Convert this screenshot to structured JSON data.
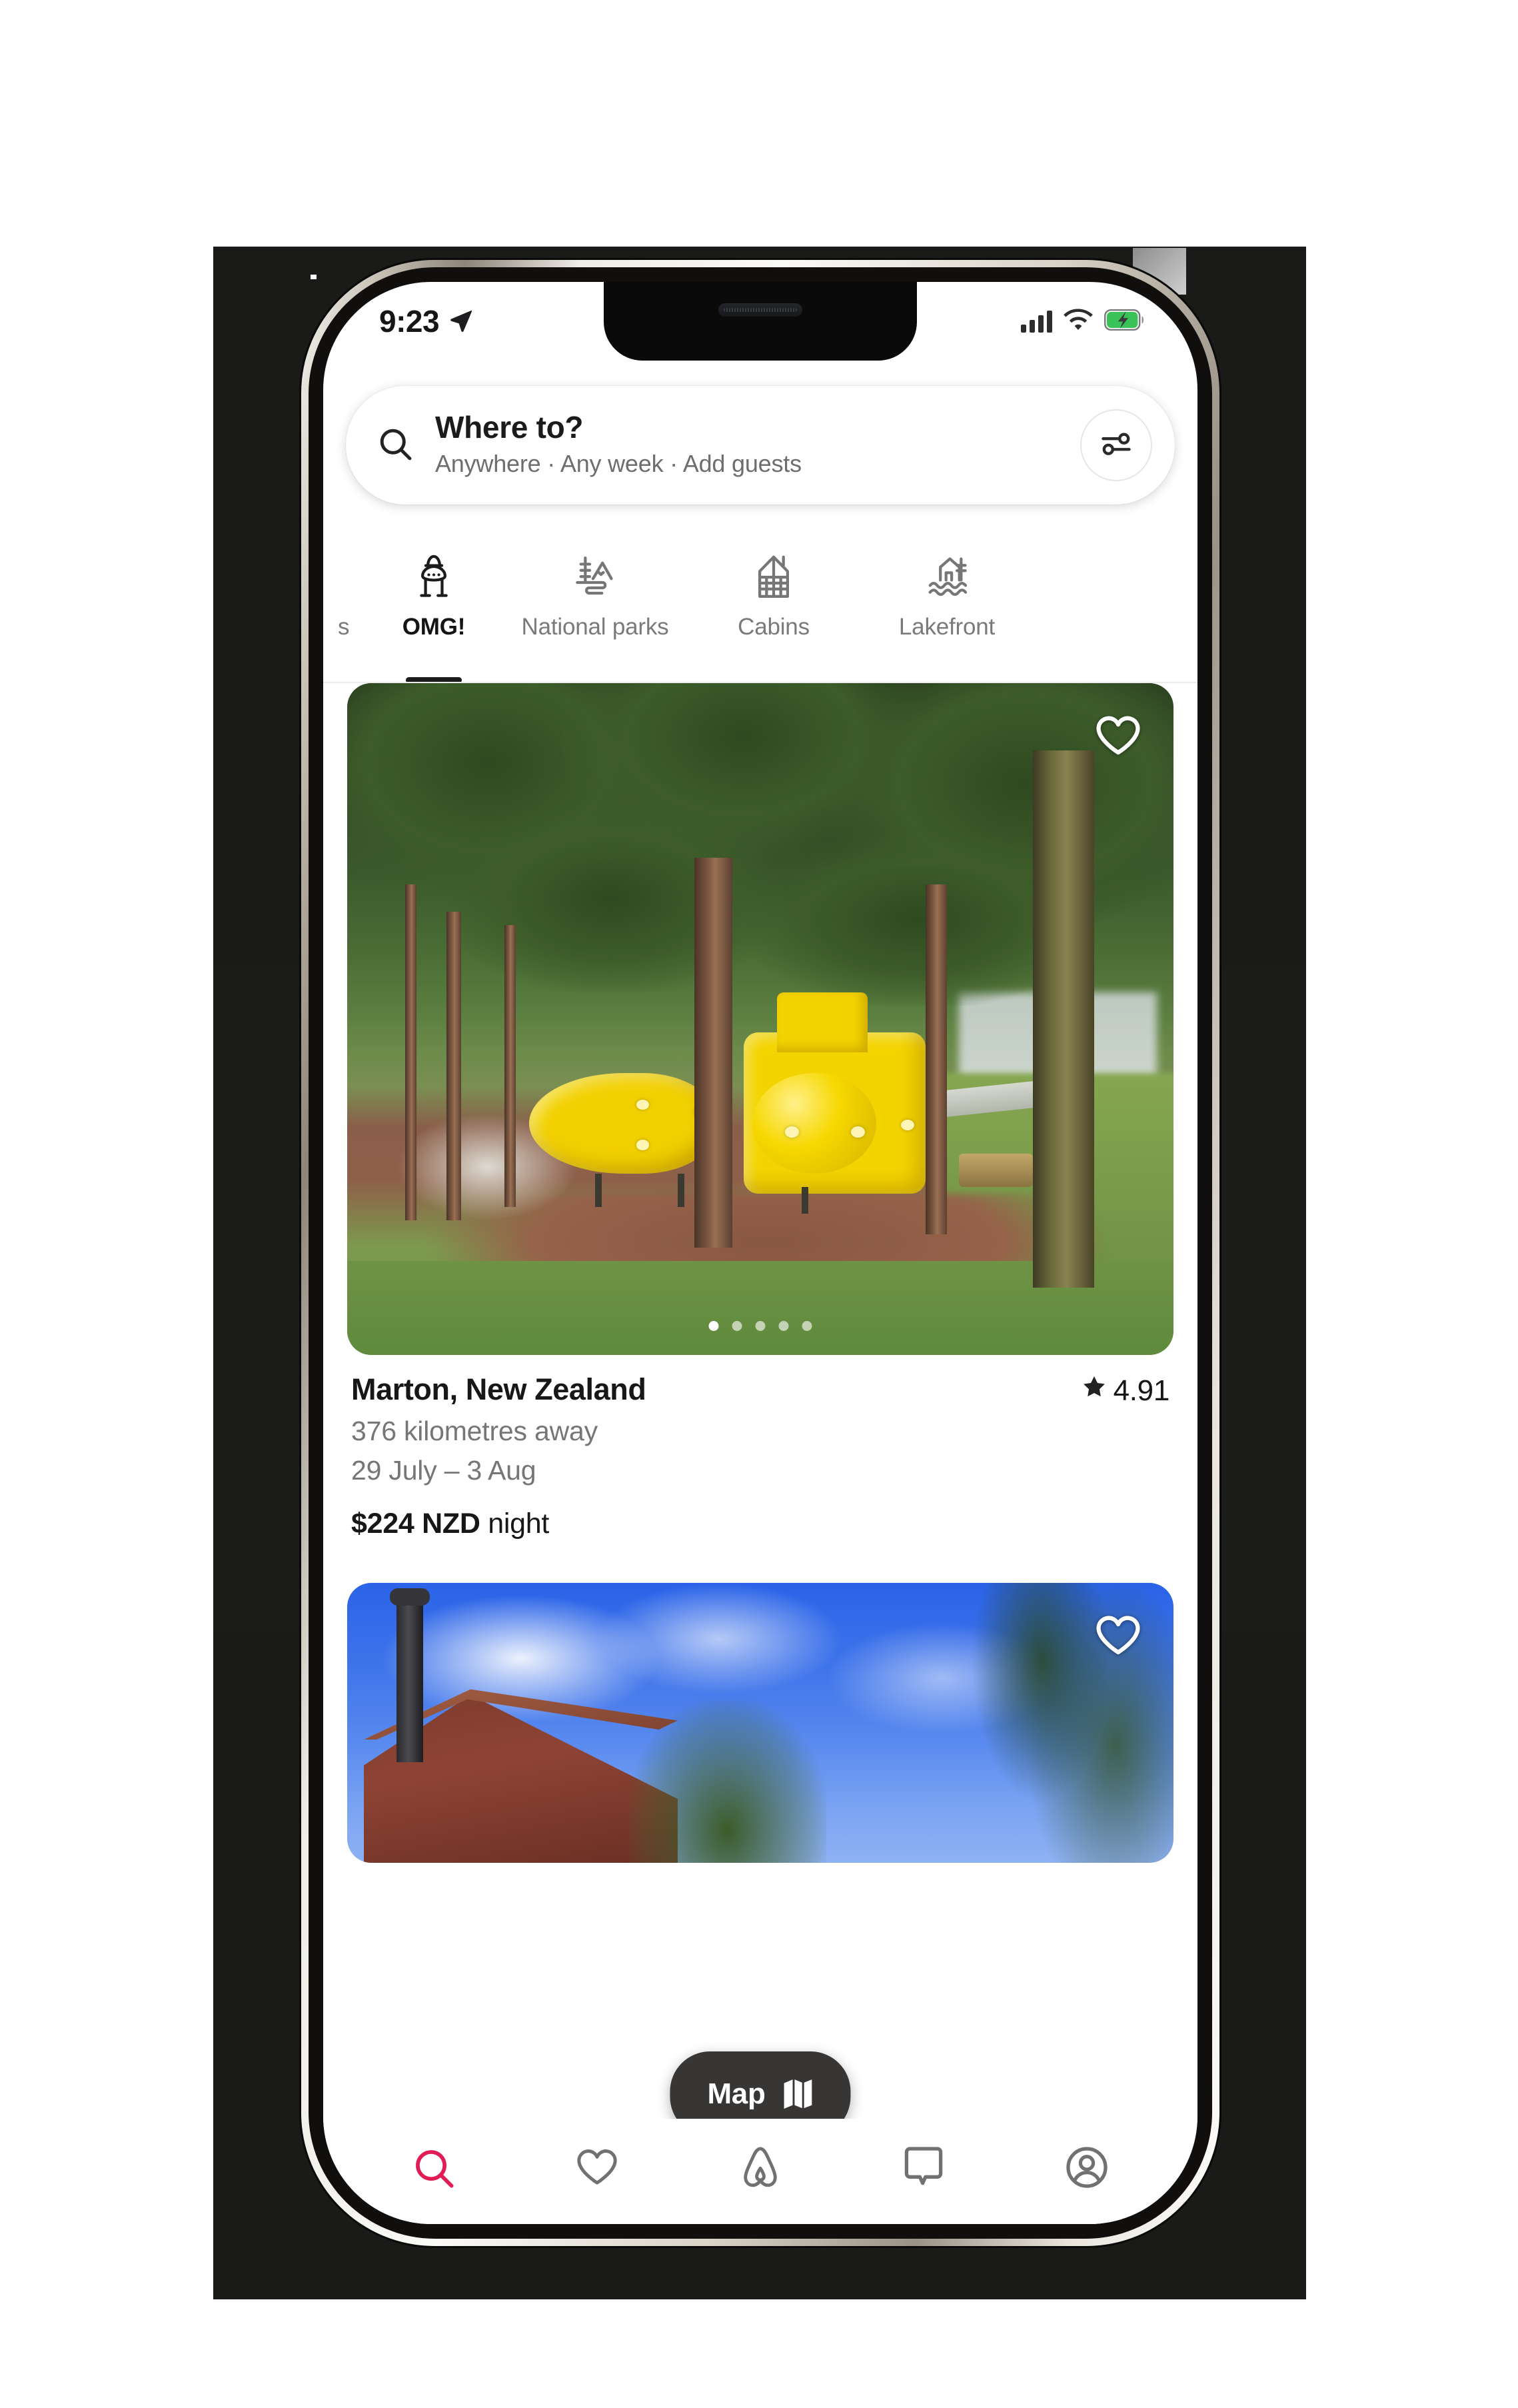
{
  "device": {
    "kind": "smartphone-mockup"
  },
  "status_bar": {
    "time": "9:23",
    "location_arrow_icon": "location-arrow-icon",
    "cellular_icon": "cellular-bars-icon",
    "wifi_icon": "wifi-icon",
    "battery_icon": "battery-charging-icon",
    "battery_color": "#39c258"
  },
  "search": {
    "icon": "search-icon",
    "title": "Where to?",
    "subtitle": "Anywhere · Any week · Add guests",
    "filter_icon": "filter-sliders-icon"
  },
  "categories": {
    "items": [
      {
        "label": "s",
        "icon": "partial-icon",
        "active": false,
        "partial": true
      },
      {
        "label": "OMG!",
        "icon": "omg-ufo-icon",
        "active": true,
        "partial": false
      },
      {
        "label": "National parks",
        "icon": "national-parks-icon",
        "active": false,
        "partial": false
      },
      {
        "label": "Cabins",
        "icon": "cabin-icon",
        "active": false,
        "partial": false
      },
      {
        "label": "Lakefront",
        "icon": "lakefront-icon",
        "active": false,
        "partial": false
      }
    ]
  },
  "listings": [
    {
      "photo_alt": "yellow submarine among tall trees",
      "favourite_icon": "heart-outline-icon",
      "favourited": false,
      "carousel": {
        "total": 5,
        "active_index": 0
      },
      "title": "Marton, New Zealand",
      "rating_star_icon": "star-icon",
      "rating": "4.91",
      "distance": "376 kilometres away",
      "dates": "29 July – 3 Aug",
      "price_amount": "$224 NZD",
      "price_unit": "night"
    },
    {
      "photo_alt": "red barn under blue sky with trees",
      "favourite_icon": "heart-outline-icon",
      "favourited": false
    }
  ],
  "map_button": {
    "label": "Map",
    "icon": "map-folded-icon"
  },
  "bottom_nav": {
    "items": [
      {
        "name": "explore",
        "icon": "search-icon",
        "active": true,
        "color": "#e11d55"
      },
      {
        "name": "wishlists",
        "icon": "heart-outline-icon",
        "active": false,
        "color": "#717171"
      },
      {
        "name": "trips",
        "icon": "airbnb-bellhop-icon",
        "active": false,
        "color": "#717171"
      },
      {
        "name": "inbox",
        "icon": "message-bubble-icon",
        "active": false,
        "color": "#717171"
      },
      {
        "name": "profile",
        "icon": "profile-avatar-icon",
        "active": false,
        "color": "#717171"
      }
    ]
  },
  "colors": {
    "accent": "#e11d55",
    "text_primary": "#171717",
    "text_secondary": "#767676",
    "map_pill": "#383634"
  }
}
